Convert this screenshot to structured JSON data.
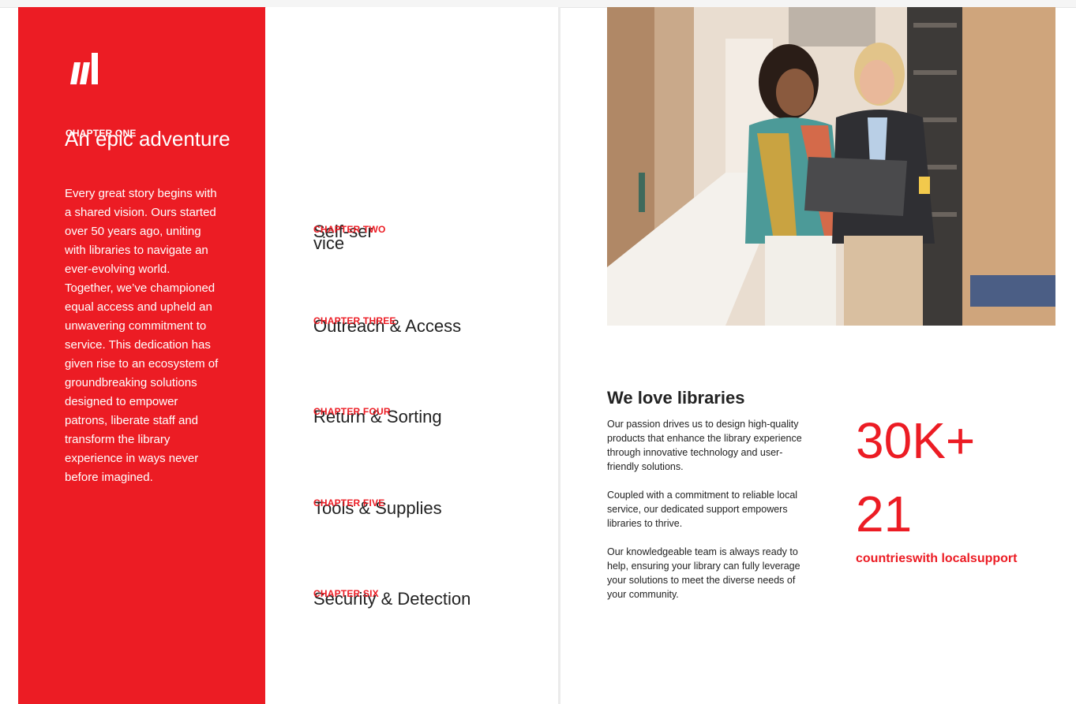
{
  "colors": {
    "accent": "#ec1c24",
    "text": "#222222",
    "background": "#ffffff"
  },
  "logo": {
    "icon": "brand-logo-icon"
  },
  "chapter_one": {
    "label": "CHAPTER ONE",
    "title": "An epic adventure",
    "body": "Every great story begins with a shared vision. Ours started over 50 years ago, uniting with libraries to navigate an ever-evolving world. Together, we’ve championed equal access and upheld an unwavering commitment to service. This dedication has given rise to an ecosystem of groundbreaking solutions designed to empower patrons, liberate staff and transform the library experience in ways never before imagined."
  },
  "chapters": [
    {
      "label": "CHAPTER TWO",
      "title": "Self-service"
    },
    {
      "label": "CHAPTER THREE",
      "title": "Outreach & Access"
    },
    {
      "label": "CHAPTER FOUR",
      "title": "Return & Sorting"
    },
    {
      "label": "CHAPTER FIVE",
      "title": "Tools & Supplies"
    },
    {
      "label": "CHAPTER SIX",
      "title": "Security & Detection"
    }
  ],
  "photo": {
    "icon": "library-photo"
  },
  "about": {
    "heading": "We love libraries",
    "paragraphs": [
      "Our passion drives us to design high-quality products that enhance the library experience through innovative technology and user-friendly solutions.",
      "Coupled with a commitment to reliable local service, our dedicated support empowers libraries to thrive.",
      "Our knowledgeable team is always ready to help, ensuring your library can fully leverage your solutions to meet the diverse needs of your community."
    ]
  },
  "stats": {
    "first_value": "30K+",
    "second_value": "21",
    "second_caption": "countrieswith localsupport"
  }
}
